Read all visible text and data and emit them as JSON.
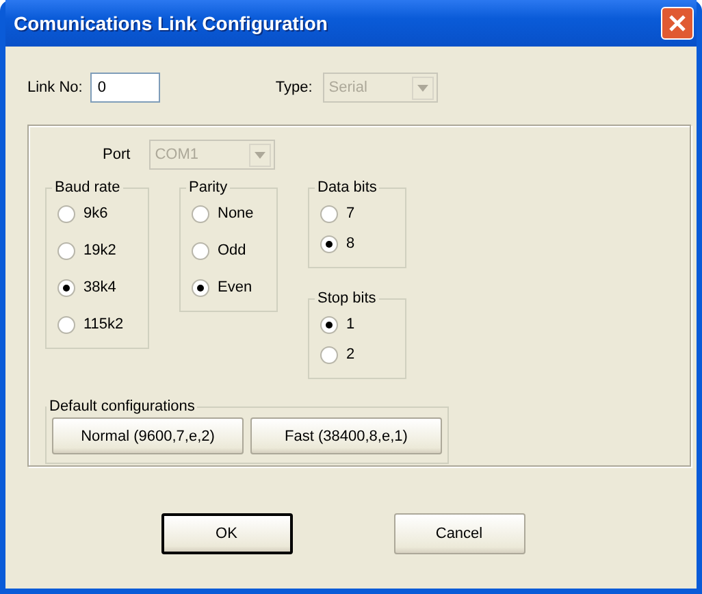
{
  "window": {
    "title": "Comunications Link Configuration"
  },
  "link_no": {
    "label": "Link No:",
    "value": "0"
  },
  "type": {
    "label": "Type:",
    "value": "Serial",
    "disabled": true
  },
  "port": {
    "label": "Port",
    "value": "COM1",
    "disabled": true
  },
  "columns": [
    [
      {
        "title": "Baud rate",
        "options": [
          {
            "label": "9k6",
            "selected": false
          },
          {
            "label": "19k2",
            "selected": false
          },
          {
            "label": "38k4",
            "selected": true
          },
          {
            "label": "115k2",
            "selected": false
          }
        ]
      }
    ],
    [
      {
        "title": "Parity",
        "options": [
          {
            "label": "None",
            "selected": false
          },
          {
            "label": "Odd",
            "selected": false
          },
          {
            "label": "Even",
            "selected": true
          }
        ]
      }
    ],
    [
      {
        "title": "Data bits",
        "options": [
          {
            "label": "7",
            "selected": false
          },
          {
            "label": "8",
            "selected": true
          }
        ]
      },
      {
        "title": "Stop bits",
        "options": [
          {
            "label": "1",
            "selected": true
          },
          {
            "label": "2",
            "selected": false
          }
        ]
      }
    ]
  ],
  "default_configurations": {
    "title": "Default configurations",
    "buttons": [
      "Normal (9600,7,e,2)",
      "Fast (38400,8,e,1)"
    ]
  },
  "buttons": [
    {
      "label": "OK",
      "default": true
    },
    {
      "label": "Cancel",
      "default": false
    }
  ]
}
